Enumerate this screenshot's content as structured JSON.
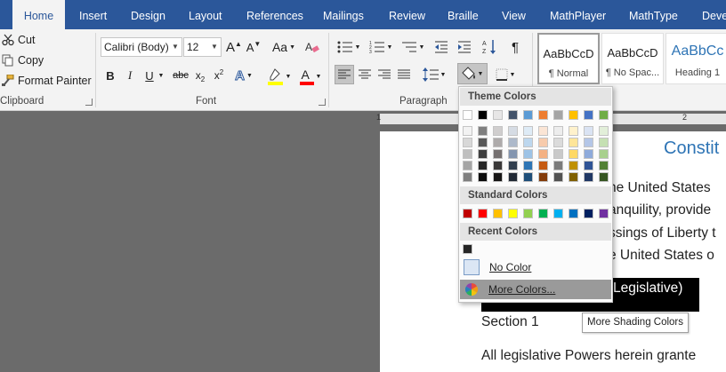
{
  "tabs": [
    "Home",
    "Insert",
    "Design",
    "Layout",
    "References",
    "Mailings",
    "Review",
    "Braille",
    "View",
    "MathPlayer",
    "MathType",
    "Deve"
  ],
  "active_tab": "Home",
  "clipboard": {
    "cut": "Cut",
    "copy": "Copy",
    "format_painter": "Format Painter",
    "group_label": "Clipboard"
  },
  "font": {
    "font_name": "Calibri (Body)",
    "font_size": "12",
    "grow": "A",
    "shrink": "A",
    "change_case": "Aa",
    "bold": "B",
    "italic": "I",
    "underline": "U",
    "strikethrough": "abc",
    "subscript": "x",
    "superscript": "x",
    "font_color": "A",
    "group_label": "Font"
  },
  "paragraph": {
    "sort": "A Z",
    "show_marks": "¶",
    "group_label": "Paragraph"
  },
  "styles": [
    {
      "sample": "AaBbCcD",
      "name": "¶ Normal"
    },
    {
      "sample": "AaBbCcD",
      "name": "¶ No Spac..."
    },
    {
      "sample": "AaBbCc",
      "name": "Heading 1"
    }
  ],
  "ruler": {
    "one": "1",
    "two": "2"
  },
  "document": {
    "heading": "Constit",
    "lines": [
      "he United States",
      "anquility, provide",
      "ssings of Liberty t",
      "e United States o"
    ],
    "article": "Legislative)",
    "section": "Section 1",
    "bottom": "All legislative Powers herein grante"
  },
  "shading_menu": {
    "theme_header": "Theme Colors",
    "theme_top": [
      "#ffffff",
      "#000000",
      "#e7e6e6",
      "#44546a",
      "#5b9bd5",
      "#ed7d31",
      "#a5a5a5",
      "#ffc000",
      "#4472c4",
      "#70ad47"
    ],
    "theme_shades": [
      [
        "#f2f2f2",
        "#7f7f7f",
        "#d0cece",
        "#d6dce4",
        "#deebf6",
        "#fbe5d5",
        "#ededed",
        "#fff2cc",
        "#dae3f3",
        "#e2efd9"
      ],
      [
        "#d8d8d8",
        "#595959",
        "#aeabab",
        "#adb9ca",
        "#bdd7ee",
        "#f7cbac",
        "#dbdbdb",
        "#fee599",
        "#b4c6e7",
        "#c5e0b3"
      ],
      [
        "#bfbfbf",
        "#3f3f3f",
        "#757070",
        "#8496b0",
        "#9dc3e6",
        "#f4b183",
        "#c9c9c9",
        "#ffd965",
        "#8eaadb",
        "#a8d08d"
      ],
      [
        "#a5a5a5",
        "#262626",
        "#3a3838",
        "#323f4f",
        "#2e75b5",
        "#c55a11",
        "#7b7b7b",
        "#bf9000",
        "#2f5496",
        "#538135"
      ],
      [
        "#7f7f7f",
        "#0c0c0c",
        "#171616",
        "#222a35",
        "#1e4e79",
        "#833c0b",
        "#525252",
        "#7f6000",
        "#203864",
        "#375623"
      ]
    ],
    "standard_header": "Standard Colors",
    "standard": [
      "#c00000",
      "#ff0000",
      "#ffc000",
      "#ffff00",
      "#92d050",
      "#00b050",
      "#00b0f0",
      "#0070c0",
      "#002060",
      "#7030a0"
    ],
    "recent_header": "Recent Colors",
    "recent": [
      "#262626"
    ],
    "no_color": "No Color",
    "more_colors": "More Colors..."
  },
  "tooltip": "More Shading Colors"
}
